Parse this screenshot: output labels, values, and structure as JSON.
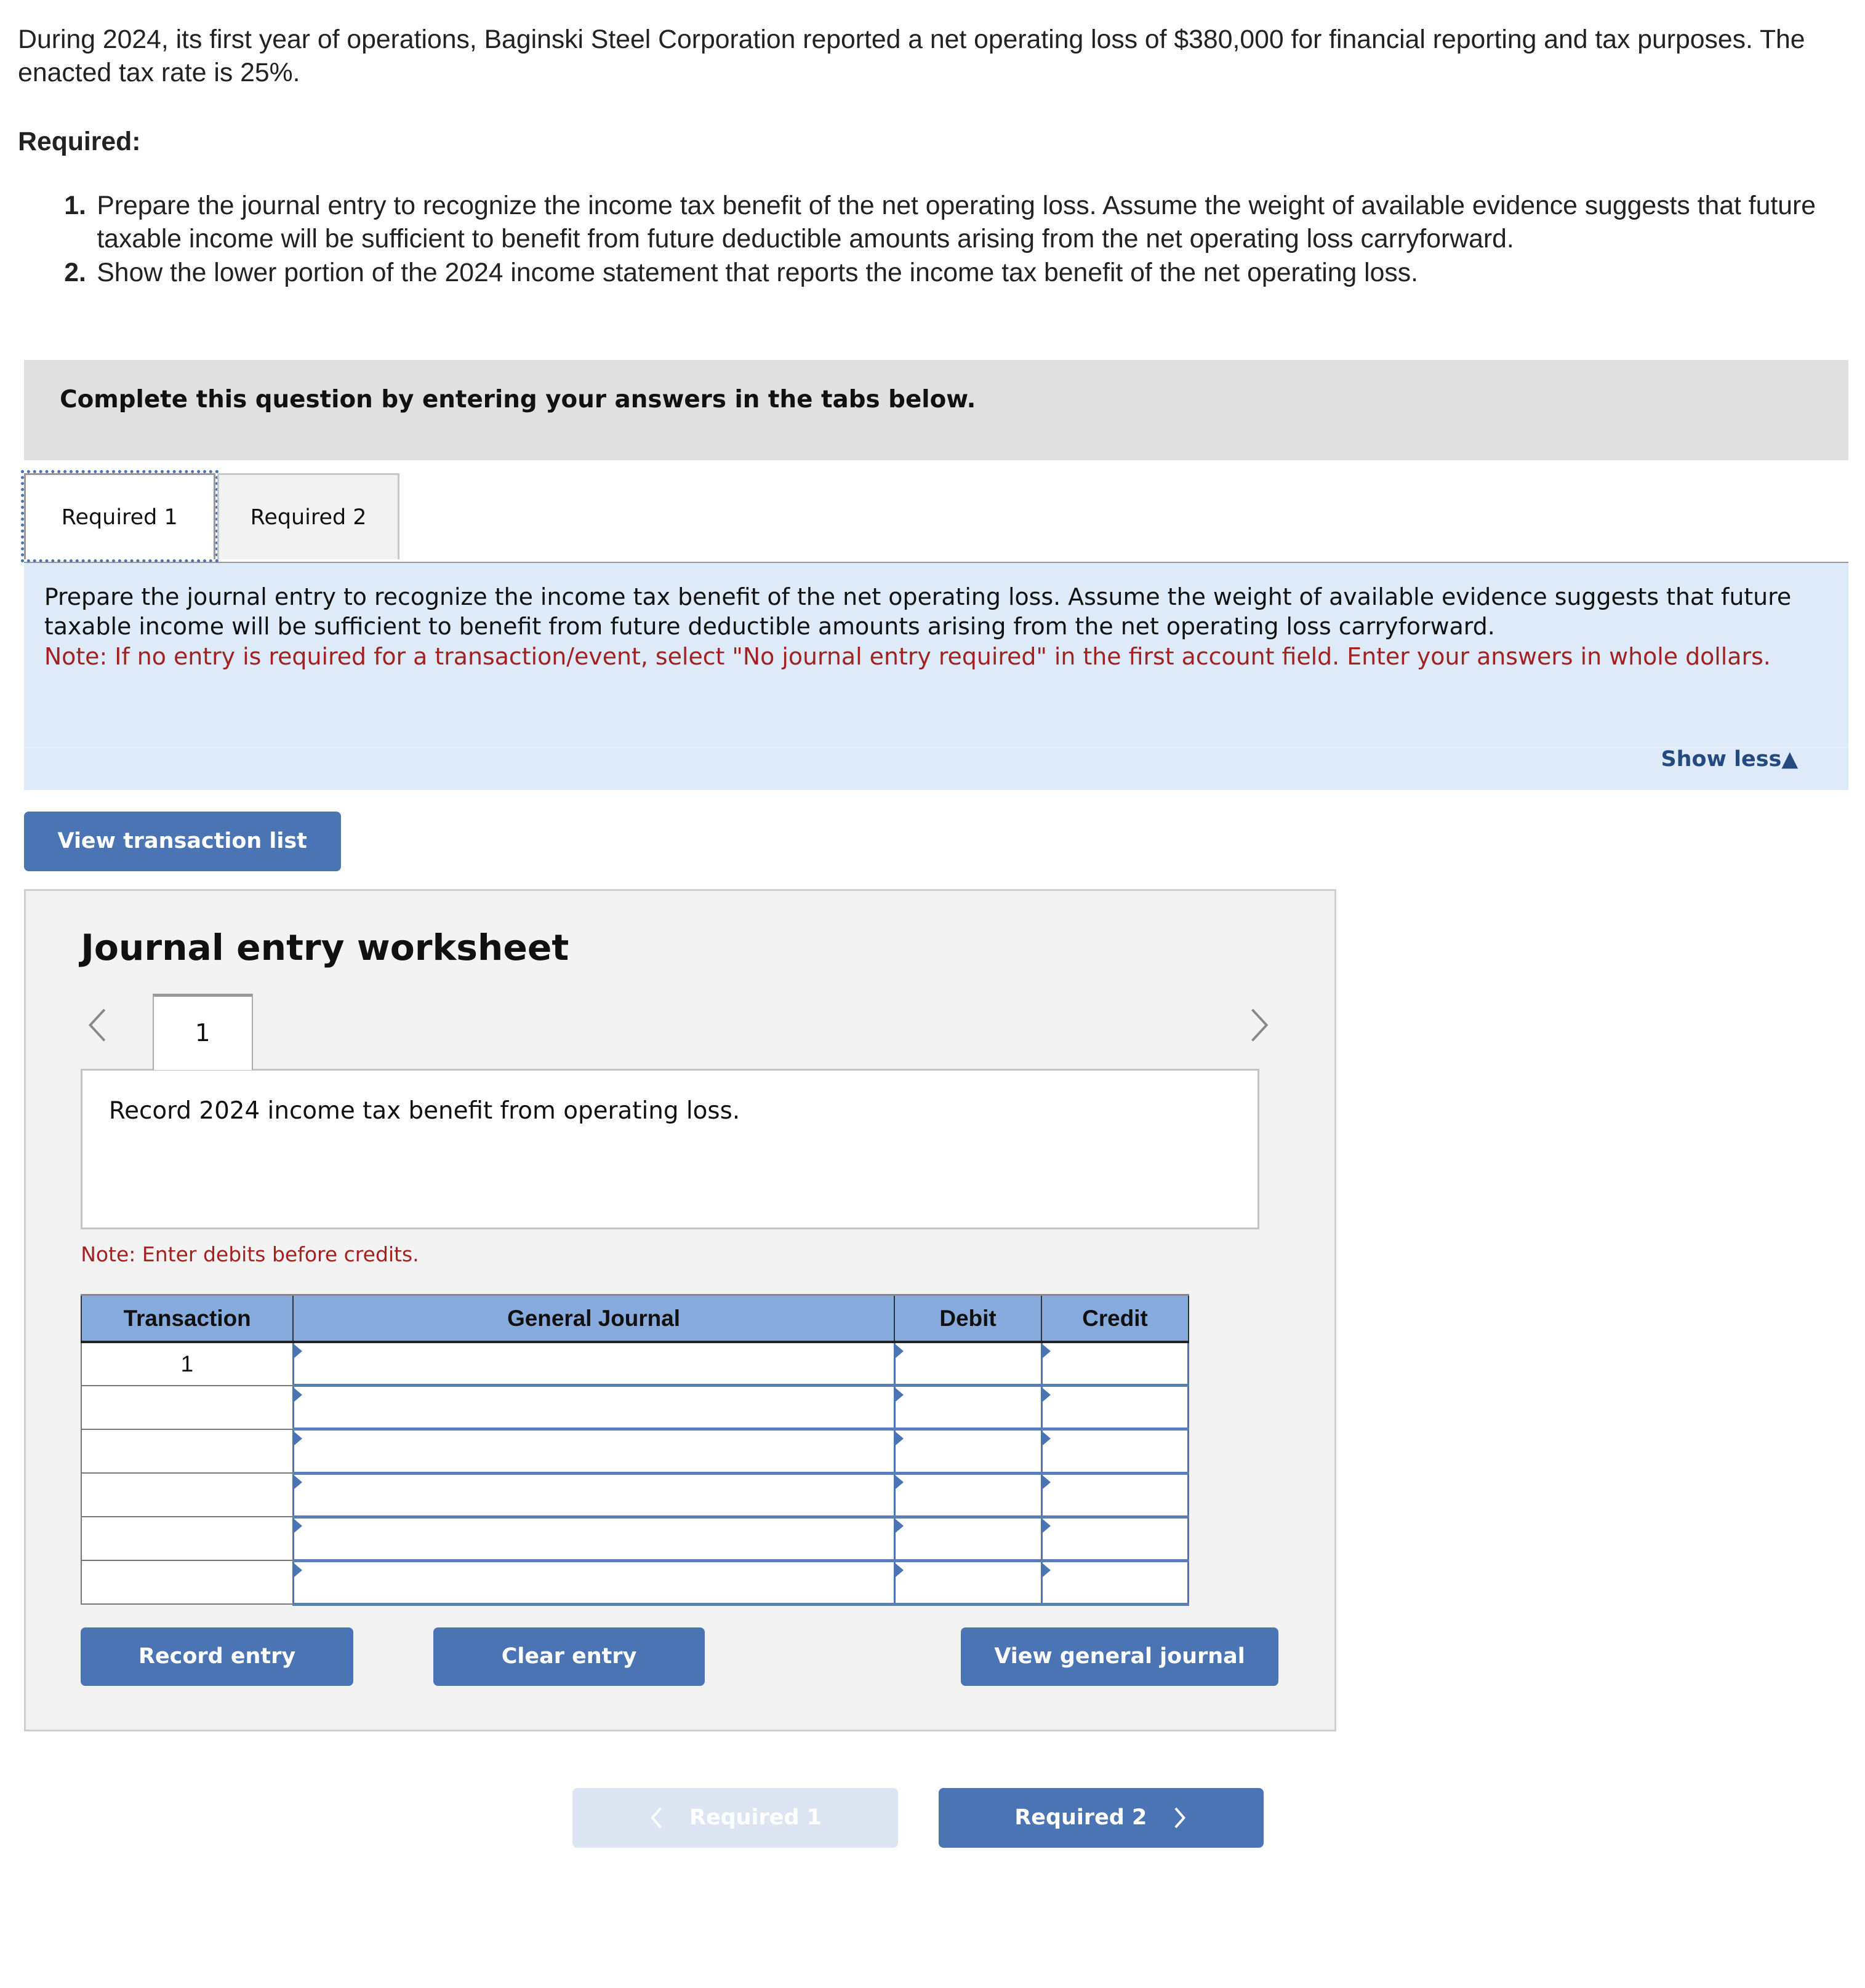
{
  "problem": {
    "intro": "During 2024, its first year of operations, Baginski Steel Corporation reported a net operating loss of $380,000 for financial reporting and tax purposes. The enacted tax rate is 25%.",
    "required_label": "Required:",
    "requirements": [
      {
        "num": "1.",
        "text": "Prepare the journal entry to recognize the income tax benefit of the net operating loss. Assume the weight of available evidence suggests that future taxable income will be sufficient to benefit from future deductible amounts arising from the net operating loss carryforward."
      },
      {
        "num": "2.",
        "text": "Show the lower portion of the 2024 income statement that reports the income tax benefit of the net operating loss."
      }
    ]
  },
  "banner": "Complete this question by entering your answers in the tabs below.",
  "tabs": [
    {
      "label": "Required 1",
      "active": true
    },
    {
      "label": "Required 2",
      "active": false
    }
  ],
  "instructions": {
    "text": "Prepare the journal entry to recognize the income tax benefit of the net operating loss. Assume the weight of available evidence suggests that future taxable income will be sufficient to benefit from future deductible amounts arising from the net operating loss carryforward.",
    "note": "Note: If no entry is required for a transaction/event, select \"No journal entry required\" in the first account field. Enter your answers in whole dollars.",
    "show_less": "Show less"
  },
  "view_transaction_list": "View transaction list",
  "worksheet": {
    "title": "Journal entry worksheet",
    "current_tab": "1",
    "description": "Record 2024 income tax benefit from operating loss.",
    "note": "Note: Enter debits before credits.",
    "columns": [
      "Transaction",
      "General Journal",
      "Debit",
      "Credit"
    ],
    "rows": [
      {
        "transaction": "1",
        "account": "",
        "debit": "",
        "credit": ""
      },
      {
        "transaction": "",
        "account": "",
        "debit": "",
        "credit": ""
      },
      {
        "transaction": "",
        "account": "",
        "debit": "",
        "credit": ""
      },
      {
        "transaction": "",
        "account": "",
        "debit": "",
        "credit": ""
      },
      {
        "transaction": "",
        "account": "",
        "debit": "",
        "credit": ""
      },
      {
        "transaction": "",
        "account": "",
        "debit": "",
        "credit": ""
      }
    ],
    "buttons": {
      "record": "Record entry",
      "clear": "Clear entry",
      "view_journal": "View general journal"
    }
  },
  "navigation": {
    "prev_label": "Required 1",
    "next_label": "Required 2"
  },
  "colors": {
    "button_blue": "#4a74b4",
    "header_blue": "#87aadd",
    "instruction_bg": "#deeaf7",
    "note_red": "#a32121",
    "link_navy": "#244a80"
  }
}
